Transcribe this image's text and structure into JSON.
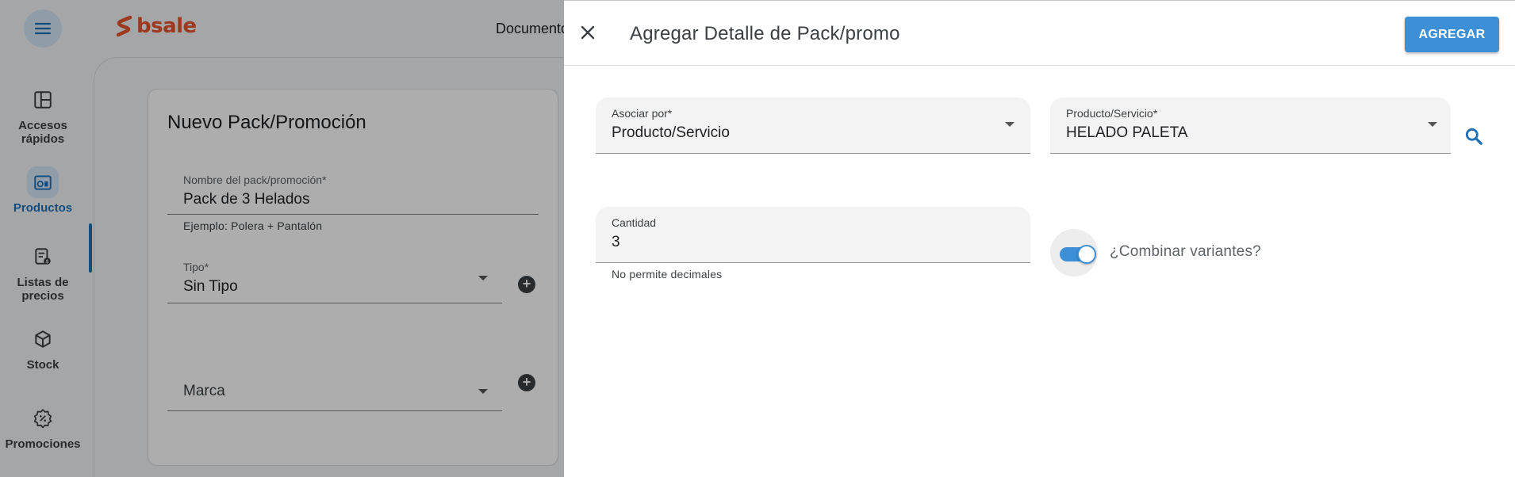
{
  "background": {
    "logo_text": "bsale",
    "top_nav_text": "Documento",
    "sidebar": {
      "items": [
        {
          "label_1": "Accesos",
          "label_2": "rápidos",
          "icon": "quick-access-icon"
        },
        {
          "label_1": "Productos",
          "label_2": "",
          "icon": "products-icon",
          "active": true
        },
        {
          "label_1": "Listas de",
          "label_2": "precios",
          "icon": "price-list-icon"
        },
        {
          "label_1": "Stock",
          "label_2": "",
          "icon": "stock-box-icon"
        },
        {
          "label_1": "Promociones",
          "label_2": "",
          "icon": "promotion-badge-icon"
        }
      ]
    },
    "form": {
      "title": "Nuevo Pack/Promoción",
      "name_label": "Nombre del pack/promoción*",
      "name_value": "Pack de 3 Helados",
      "name_hint": "Ejemplo: Polera + Pantalón",
      "type_label": "Tipo*",
      "type_value": "Sin Tipo",
      "brand_placeholder": "Marca"
    }
  },
  "drawer": {
    "title": "Agregar Detalle de Pack/promo",
    "add_label": "AGREGAR",
    "associate_label": "Asociar por*",
    "associate_value": "Producto/Servicio",
    "product_label": "Producto/Servicio*",
    "product_value": "HELADO PALETA",
    "quantity_label": "Cantidad",
    "quantity_value": "3",
    "quantity_hint": "No permite decimales",
    "combine_label": "¿Combinar variantes?",
    "combine_enabled": true
  },
  "colors": {
    "accent": "#3d8fd6",
    "brand": "#e8542e",
    "active_nav": "#1d70b8"
  }
}
